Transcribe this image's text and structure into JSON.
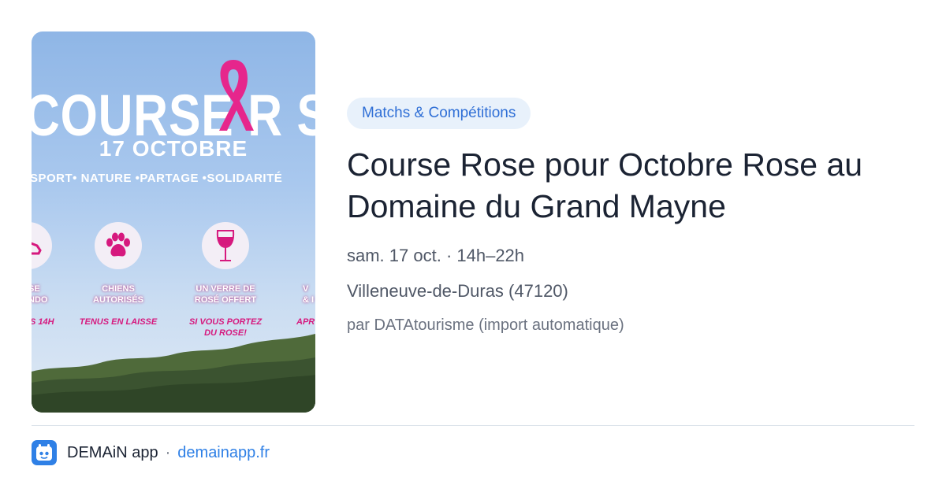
{
  "poster": {
    "title": "COURSE R   SE",
    "date": "17 OCTOBRE",
    "tagline": "SPORT• NATURE •PARTAGE •SOLIDARITÉ",
    "features": [
      {
        "label_l1": "SE",
        "label_l2": "NDO",
        "sub": "S 14H",
        "icon": "sneaker-icon"
      },
      {
        "label_l1": "CHIENS",
        "label_l2": "AUTORISÉS",
        "sub": "TENUS EN LAISSE",
        "icon": "paw-icon"
      },
      {
        "label_l1": "UN VERRE DE",
        "label_l2": "ROSÉ OFFERT",
        "sub_l1": "SI VOUS PORTEZ",
        "sub_l2": "DU ROSE!",
        "icon": "wine-glass-icon"
      },
      {
        "label_l1": "V",
        "label_l2": "& I",
        "sub": "APR",
        "icon": ""
      }
    ],
    "colors": {
      "accent": "#d6197e",
      "sky": "#a9c8ee"
    }
  },
  "event": {
    "category": "Matchs & Compétitions",
    "title": "Course Rose pour Octobre Rose au Domaine du Grand Mayne",
    "datetime": "sam. 17 oct. · 14h–22h",
    "location": "Villeneuve-de-Duras (47120)",
    "source": "par DATAtourisme (import automatique)"
  },
  "footer": {
    "app_name": "DEMAiN app",
    "separator": "·",
    "domain": "demainapp.fr",
    "icon": "demain-app-icon"
  },
  "colors": {
    "title": "#1b2333",
    "link": "#2f80e6",
    "chip_bg": "#e8f1fb",
    "chip_text": "#2f6fd6"
  }
}
